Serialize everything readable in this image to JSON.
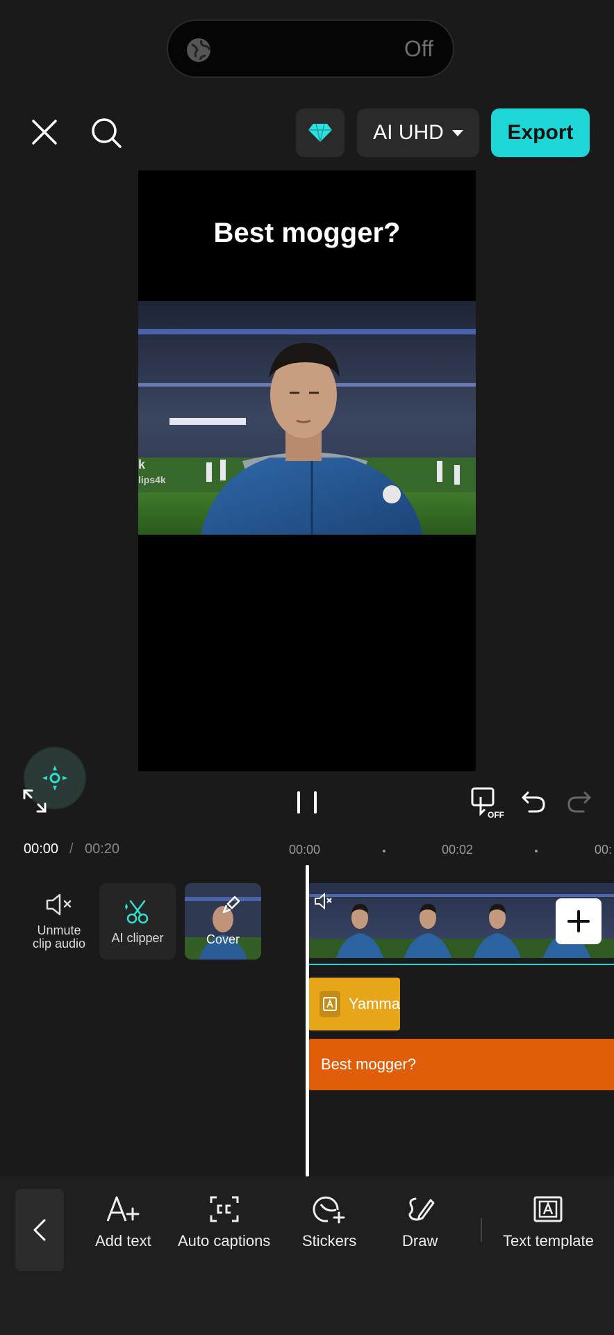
{
  "status_pill": {
    "icon": "globe-icon",
    "state": "Off"
  },
  "top_bar": {
    "close_icon": "close-icon",
    "search_icon": "search-icon",
    "pro_icon": "diamond-icon",
    "quality_label": "AI UHD",
    "export_label": "Export"
  },
  "preview": {
    "title_text": "Best mogger?",
    "watermark_lines": [
      "k",
      "lips4k"
    ]
  },
  "playback": {
    "fullscreen_icon": "fullscreen-icon",
    "keyframe_icon": "keyframe-off-icon",
    "keyframe_badge": "OFF",
    "undo_icon": "undo-icon",
    "redo_icon": "redo-icon"
  },
  "timeline": {
    "current_time": "00:00",
    "separator": "/",
    "total_time": "00:20",
    "ruler": [
      "00:00",
      "00:02",
      "00:"
    ],
    "unmute_label_line1": "Unmute",
    "unmute_label_line2": "clip audio",
    "ai_clipper_label": "AI clipper",
    "cover_label": "Cover",
    "sticker_clip_label": "Yamma",
    "text_clip_label": "Best mogger?"
  },
  "toolbar": {
    "items": [
      {
        "label": "Add text",
        "icon": "add-text-icon"
      },
      {
        "label": "Auto captions",
        "icon": "captions-icon"
      },
      {
        "label": "Stickers",
        "icon": "stickers-icon"
      },
      {
        "label": "Draw",
        "icon": "draw-icon"
      },
      {
        "label": "Text template",
        "icon": "text-template-icon"
      }
    ]
  },
  "colors": {
    "accent": "#1fd6d6",
    "sticker_clip": "#e7a51a",
    "text_clip": "#e05d0a",
    "background": "#1a1a1a"
  }
}
